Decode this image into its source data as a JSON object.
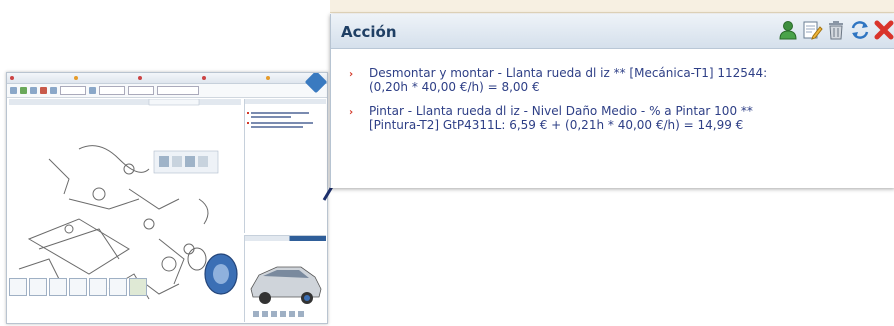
{
  "panel": {
    "title": "Acción",
    "icons": [
      "user-icon",
      "edit-icon",
      "trash-icon",
      "refresh-icon",
      "close-icon"
    ],
    "items": [
      {
        "line1": "Desmontar y montar - Llanta rueda dl iz ** [Mecánica-T1] 112544:",
        "line2": "(0,20h * 40,00 €/h) = 8,00 €"
      },
      {
        "line1": "Pintar - Llanta rueda dl iz - Nivel Daño Medio - % a Pintar 100 **",
        "line2": "[Pintura-T2] GtP4311L: 6,59 € + (0,21h * 40,00 €/h) = 14,99 €"
      }
    ]
  },
  "colors": {
    "accent": "#1f3f64",
    "bullet": "#d43a2a",
    "text": "#2e3f86",
    "close": "#d9342b"
  }
}
